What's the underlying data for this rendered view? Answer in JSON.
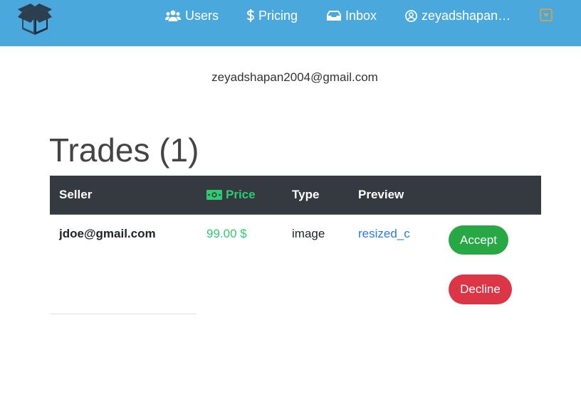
{
  "navbar": {
    "logo_icon": "box-icon",
    "background": "#4aa8dc",
    "users_label": "Users",
    "pricing_label": "Pricing",
    "inbox_label": "Inbox",
    "user_label": "zeyadshapan2004@gmail.com",
    "dropdown_icon": "caret-square-down-icon"
  },
  "profile": {
    "email": "zeyadshapan2004@gmail.com"
  },
  "trades": {
    "title": "Trades (1)",
    "columns": {
      "seller": "Seller",
      "price": "Price",
      "type": "Type",
      "preview": "Preview"
    },
    "rows": [
      {
        "seller": "jdoe@gmail.com",
        "price": "99.00 $",
        "type": "image",
        "preview": "resized_c",
        "accept_label": "Accept",
        "decline_label": "Decline"
      }
    ]
  },
  "colors": {
    "price": "#2ecc71",
    "accept": "#28a745",
    "decline": "#dc3545",
    "link": "#2a7ae2",
    "table_header": "#343a40"
  }
}
